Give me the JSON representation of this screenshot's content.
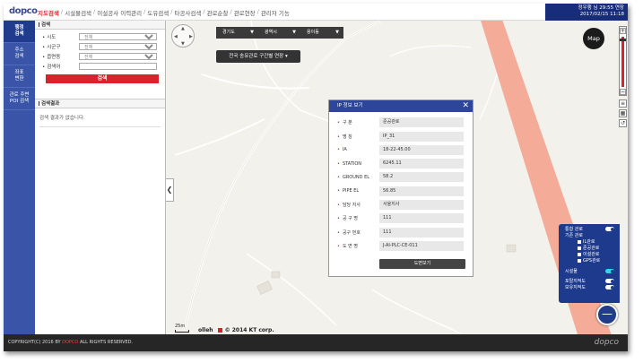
{
  "header": {
    "logo": "dopco",
    "menu": [
      "지도검색",
      "시설물검색",
      "이설공사 이력관리",
      "도유검색",
      "타공사검색",
      "관로순찰",
      "관로현장",
      "관리자 기능"
    ],
    "user_line1": "정우행 님 29:55   연장",
    "user_line2": "2017/02/15 11:18"
  },
  "leftnav": {
    "items": [
      "행정\n검색",
      "주소\n검색",
      "좌표\n변환",
      "관로 주변\nPOI 검색"
    ]
  },
  "panel": {
    "search_title": "검색",
    "fields": [
      {
        "label": "시도",
        "value": "전체"
      },
      {
        "label": "시군구",
        "value": "전체"
      },
      {
        "label": "읍면동",
        "value": "전체"
      },
      {
        "label": "검색어",
        "value": ""
      }
    ],
    "search_button": "검색",
    "results_title": "검색결과",
    "results_empty": "검색 결과가 없습니다."
  },
  "map": {
    "dropdowns": [
      "경기도",
      "광역시",
      "용이동"
    ],
    "route_button": "전국 송유관로 구간별 연장",
    "map_button": "Map",
    "scale": "25m",
    "olleh": "olleh",
    "copyright": "© 2014 KT corp."
  },
  "popup": {
    "title": "IP 정보 보기",
    "rows": [
      {
        "label": "구   분",
        "value": "준공관로"
      },
      {
        "label": "명   칭",
        "value": "IP_31"
      },
      {
        "label": "IA",
        "value": "18-22-45.00"
      },
      {
        "label": "STATION",
        "value": "6245.11"
      },
      {
        "label": "GROUND EL",
        "value": "58.2"
      },
      {
        "label": "PIPE EL",
        "value": "56.85"
      },
      {
        "label": "담당 지사",
        "value": "서울지사"
      },
      {
        "label": "공 구 명",
        "value": "111"
      },
      {
        "label": "공구 번호",
        "value": "111"
      },
      {
        "label": "도 면 명",
        "value": "J-AI-PLC-CE-011"
      }
    ],
    "drawing_button": "도면보기"
  },
  "layers": {
    "pipeline_total": "통합 관로",
    "existing_pipeline": "기존 관로",
    "items": [
      "IL관로",
      "준공관로",
      "이설관로",
      "GPS관로"
    ],
    "facilities": "시설물",
    "tbm": "포탈지적도",
    "cadastral": "보유지적도"
  },
  "footer": {
    "copyright_prefix": "COPYRIGHT(C) 2016 BY ",
    "copyright_brand": "DOPCO",
    "copyright_suffix": " ALL RIGHTS RESERVED.",
    "logo": "dopco"
  },
  "colors": {
    "accent": "#d8232a",
    "nav": "#3a55a8",
    "header_blue": "#172c7a",
    "pipeline": "#f4a38f"
  }
}
